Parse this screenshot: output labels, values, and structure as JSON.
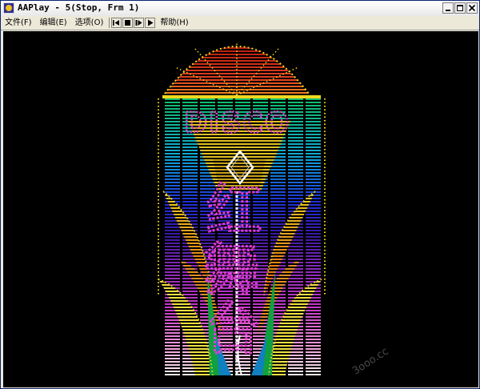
{
  "window": {
    "title": "AAPlay - 5(Stop, Frm 1)",
    "icon": "aaplay-app-icon",
    "controls": [
      "minimize-icon",
      "maximize-icon",
      "close-icon"
    ]
  },
  "menu": {
    "file": "文件(F)",
    "edit": "编辑(E)",
    "options": "选项(O)",
    "help": "帮助(H)"
  },
  "toolbar": {
    "buttons": [
      "rewind-icon",
      "stop-icon",
      "step-forward-icon",
      "play-icon"
    ]
  },
  "artwork": {
    "word_top": "DISCO",
    "chars": [
      "红",
      "舞",
      "台"
    ],
    "colors": {
      "fan": "#d42a18",
      "border": "#e8e800",
      "neon_text": "#e03cd0",
      "frame": "#f2d820"
    }
  },
  "watermark": "3ooo.cc"
}
